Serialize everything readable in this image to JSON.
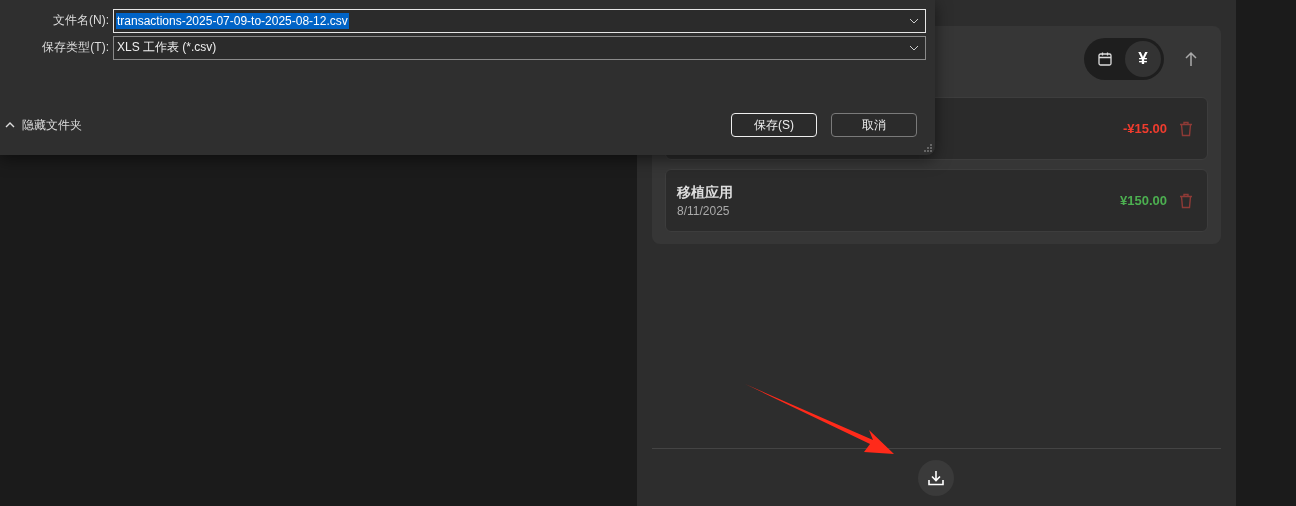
{
  "save_dialog": {
    "filename_label": "文件名(N):",
    "filename_value": "transactions-2025-07-09-to-2025-08-12.csv",
    "filename_selected": true,
    "filetype_label": "保存类型(T):",
    "filetype_value": "XLS 工作表 (*.csv)",
    "folders_toggle": "隐藏文件夹",
    "buttons": [
      {
        "label": "保存(S)",
        "default": true
      },
      {
        "label": "取消",
        "default": false
      }
    ]
  },
  "sort_toggle": [
    {
      "kind": "calendar",
      "selected": false
    },
    {
      "kind": "text",
      "label": "¥",
      "selected": true
    }
  ],
  "transactions": [
    {
      "amount": "-¥15.00",
      "kind": "expense"
    },
    {
      "title": "移植应用",
      "date": "8/11/2025",
      "amount": "¥150.00",
      "kind": "income"
    }
  ]
}
